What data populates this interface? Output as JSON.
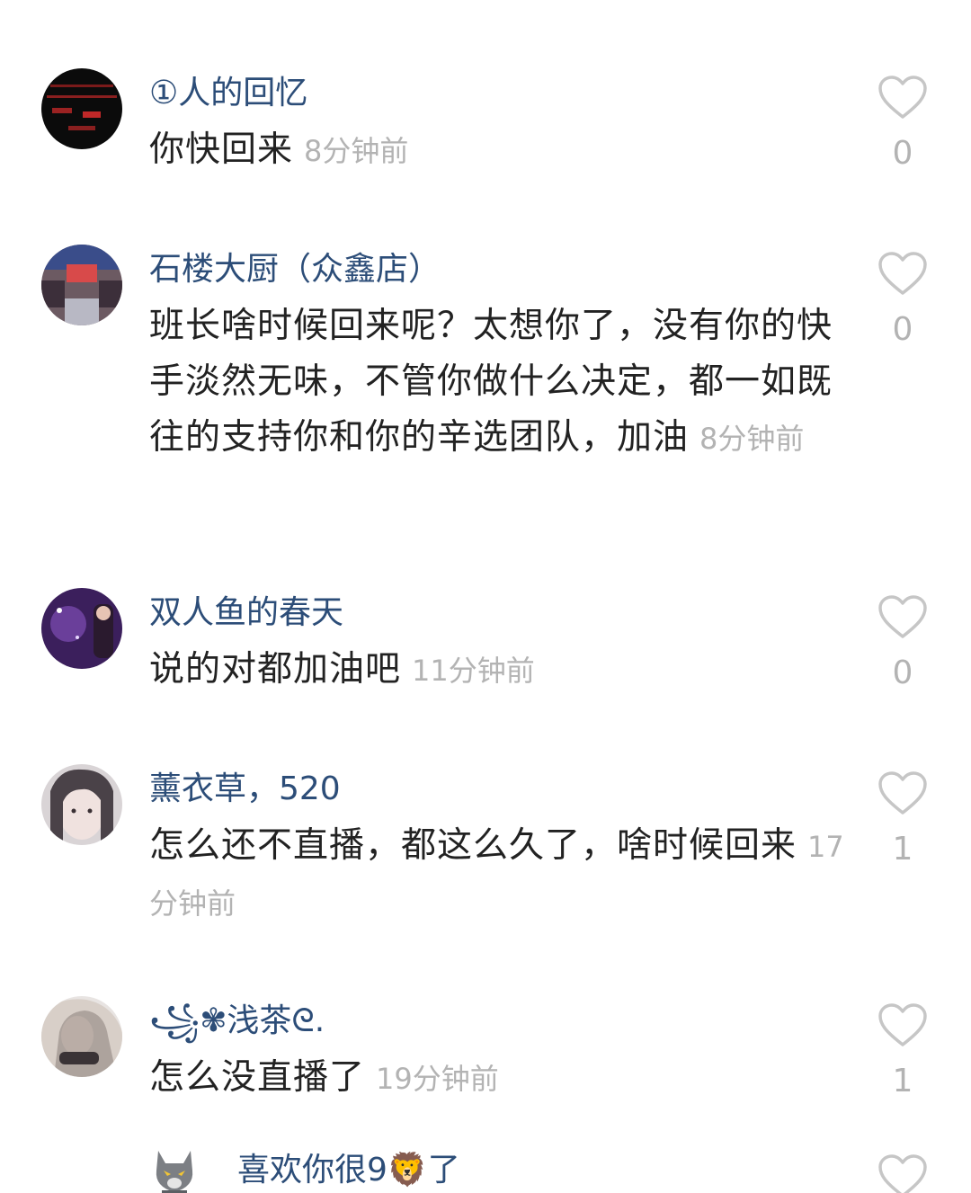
{
  "comments": [
    {
      "username": "①人的回忆",
      "text": "你快回来",
      "time": "8分钟前",
      "likes": "0"
    },
    {
      "username": "石楼大厨（众鑫店）",
      "text": "班长啥时候回来呢？太想你了，没有你的快手淡然无味，不管你做什么决定，都一如既往的支持你和你的辛选团队，加油",
      "time": "8分钟前",
      "likes": "0"
    },
    {
      "username": "双人鱼的春天",
      "text": "说的对都加油吧",
      "time": "11分钟前",
      "likes": "0"
    },
    {
      "username": "薰衣草，520",
      "text": "怎么还不直播，都这么久了，啥时候回来",
      "time": "17分钟前",
      "likes": "1"
    },
    {
      "username": "꧁✾浅茶ᘓ.",
      "text": "怎么没直播了",
      "time": "19分钟前",
      "likes": "1"
    },
    {
      "username": "喜欢你很9🦁了"
    }
  ],
  "colors": {
    "username": "#2c4d78",
    "text": "#222222",
    "muted": "#b3b3b3"
  },
  "icons": {
    "like": "heart-outline-icon",
    "reply_avatar": "wolf-mascot-icon"
  }
}
